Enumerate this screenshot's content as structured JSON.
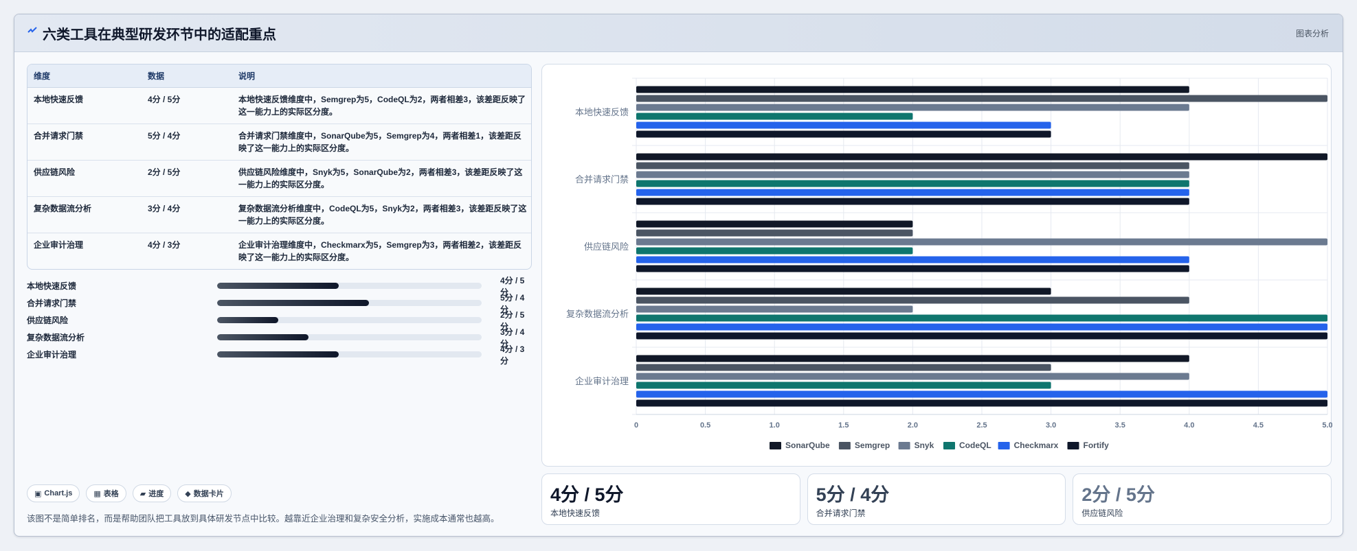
{
  "header": {
    "title": "六类工具在典型研发环节中的适配重点",
    "tag": "图表分析"
  },
  "table": {
    "headers": [
      "维度",
      "数据",
      "说明"
    ],
    "rows": [
      {
        "dim": "本地快速反馈",
        "data": "4分 / 5分",
        "desc": "本地快速反馈维度中，Semgrep为5，CodeQL为2，两者相差3，该差距反映了这一能力上的实际区分度。"
      },
      {
        "dim": "合并请求门禁",
        "data": "5分 / 4分",
        "desc": "合并请求门禁维度中，SonarQube为5，Semgrep为4，两者相差1，该差距反映了这一能力上的实际区分度。"
      },
      {
        "dim": "供应链风险",
        "data": "2分 / 5分",
        "desc": "供应链风险维度中，Snyk为5，SonarQube为2，两者相差3，该差距反映了这一能力上的实际区分度。"
      },
      {
        "dim": "复杂数据流分析",
        "data": "3分 / 4分",
        "desc": "复杂数据流分析维度中，CodeQL为5，Snyk为2，两者相差3，该差距反映了这一能力上的实际区分度。"
      },
      {
        "dim": "企业审计治理",
        "data": "4分 / 3分",
        "desc": "企业审计治理维度中，Checkmarx为5，Semgrep为3，两者相差2，该差距反映了这一能力上的实际区分度。"
      }
    ]
  },
  "progress": [
    {
      "label": "本地快速反馈",
      "value": "4分 / 5分",
      "level": 0.46
    },
    {
      "label": "合并请求门禁",
      "value": "5分 / 4分",
      "level": 0.575
    },
    {
      "label": "供应链风险",
      "value": "2分 / 5分",
      "level": 0.23
    },
    {
      "label": "复杂数据流分析",
      "value": "3分 / 4分",
      "level": 0.345
    },
    {
      "label": "企业审计治理",
      "value": "4分 / 3分",
      "level": 0.46
    }
  ],
  "chips": [
    {
      "icon": "▣",
      "label": "Chart.js"
    },
    {
      "icon": "▦",
      "label": "表格"
    },
    {
      "icon": "▰",
      "label": "进度"
    },
    {
      "icon": "◆",
      "label": "数据卡片"
    }
  ],
  "note": "该图不是简单排名，而是帮助团队把工具放到具体研发节点中比较。越靠近企业治理和复杂安全分析，实施成本通常也越高。",
  "kpis": [
    {
      "value": "4分 / 5分",
      "label": "本地快速反馈",
      "color": "#0f172a"
    },
    {
      "value": "5分 / 4分",
      "label": "合并请求门禁",
      "color": "#334155"
    },
    {
      "value": "2分 / 5分",
      "label": "供应链风险",
      "color": "#64748b"
    }
  ],
  "chart_data": {
    "type": "bar",
    "orientation": "horizontal",
    "categories": [
      "本地快速反馈",
      "合并请求门禁",
      "供应链风险",
      "复杂数据流分析",
      "企业审计治理"
    ],
    "series": [
      {
        "name": "SonarQube",
        "color": "#111827",
        "values": [
          4,
          5,
          2,
          3,
          4
        ]
      },
      {
        "name": "Semgrep",
        "color": "#4b5563",
        "values": [
          5,
          4,
          2,
          4,
          3
        ]
      },
      {
        "name": "Snyk",
        "color": "#6b7a90",
        "values": [
          4,
          4,
          5,
          2,
          4
        ]
      },
      {
        "name": "CodeQL",
        "color": "#0f766e",
        "values": [
          2,
          4,
          2,
          5,
          3
        ]
      },
      {
        "name": "Checkmarx",
        "color": "#2563eb",
        "values": [
          3,
          4,
          4,
          5,
          5
        ]
      },
      {
        "name": "Fortify",
        "color": "#0f172a",
        "values": [
          3,
          4,
          4,
          5,
          5
        ]
      }
    ],
    "xlim": [
      0,
      5
    ],
    "xticks": [
      "0",
      "0.5",
      "1.0",
      "1.5",
      "2.0",
      "2.5",
      "3.0",
      "3.5",
      "4.0",
      "4.5",
      "5.0"
    ],
    "grid": true,
    "legend": "bottom"
  }
}
